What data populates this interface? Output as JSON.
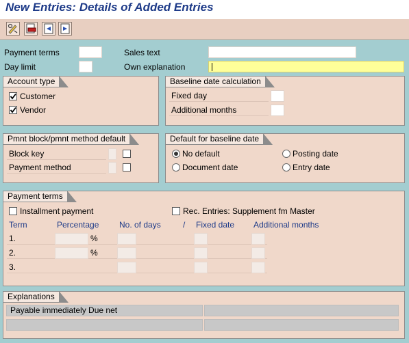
{
  "title": "New Entries: Details of Added Entries",
  "toolbar": {
    "buttons": [
      {
        "name": "display-change-icon"
      },
      {
        "name": "delete-icon"
      },
      {
        "name": "previous-entry-icon"
      },
      {
        "name": "next-entry-icon"
      }
    ]
  },
  "header": {
    "payment_terms_label": "Payment terms",
    "payment_terms_value": "",
    "day_limit_label": "Day limit",
    "day_limit_value": "",
    "sales_text_label": "Sales text",
    "sales_text_value": "",
    "own_explanation_label": "Own explanation",
    "own_explanation_value": ""
  },
  "account_type": {
    "title": "Account type",
    "customer_label": "Customer",
    "customer_checked": true,
    "vendor_label": "Vendor",
    "vendor_checked": true
  },
  "baseline_calc": {
    "title": "Baseline date calculation",
    "fixed_day_label": "Fixed day",
    "additional_months_label": "Additional months"
  },
  "pmnt_block": {
    "title": "Pmnt block/pmnt method default",
    "block_key_label": "Block key",
    "payment_method_label": "Payment method"
  },
  "default_baseline": {
    "title": "Default for baseline date",
    "no_default_label": "No default",
    "document_date_label": "Document date",
    "posting_date_label": "Posting date",
    "entry_date_label": "Entry date",
    "selected": "No default"
  },
  "payment_terms": {
    "title": "Payment terms",
    "installment_label": "Installment payment",
    "installment_checked": false,
    "rec_entries_label": "Rec. Entries: Supplement fm Master",
    "rec_entries_checked": false,
    "columns": {
      "term": "Term",
      "percentage": "Percentage",
      "days": "No. of days",
      "slash": "/",
      "fixed_date": "Fixed date",
      "additional_months": "Additional months"
    },
    "rows": [
      {
        "term": "1.",
        "unit": "%"
      },
      {
        "term": "2.",
        "unit": "%"
      },
      {
        "term": "3.",
        "unit": ""
      }
    ]
  },
  "explanations": {
    "title": "Explanations",
    "line1": "Payable immediately Due net",
    "line1b": "",
    "line2": "",
    "line2b": ""
  },
  "colors": {
    "background": "#a3cdd0",
    "group": "#f0d8ca",
    "title": "#1d3a88",
    "required": "#ffff99"
  }
}
